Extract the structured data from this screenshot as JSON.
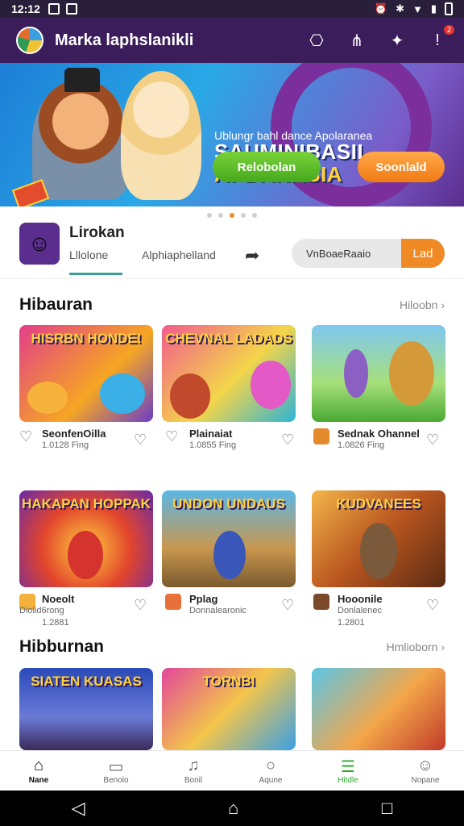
{
  "status": {
    "time": "12:12"
  },
  "app": {
    "title": "Marka laphslanikli",
    "badge": "2"
  },
  "banner": {
    "title_line1": "SAUMINIBASIL",
    "title_line2": "APDANASIA",
    "subtitle": "Ublungr bahl dance Apolaranea",
    "button_green": "Relobolan",
    "button_orange": "Soonlald"
  },
  "profile": {
    "name": "Lirokan",
    "tab1": "Lllolone",
    "tab2": "Alphiaphelland",
    "toggle_left": "VnBoaeRaaio",
    "toggle_right": "Lad"
  },
  "sections": [
    {
      "title": "Hibauran",
      "more": "Hiloobn"
    },
    {
      "title": "Hibburnan",
      "more": "Hmlioborn"
    }
  ],
  "row1": [
    {
      "thumb": "HISRBN HONDE!",
      "title": "SeonfenOilla",
      "sub": "1.0128 Fing"
    },
    {
      "thumb": "CHEVNAL LADADS",
      "title": "Plainaiat",
      "sub": "1.0855 Fing"
    },
    {
      "thumb": "",
      "title": "Sednak Ohannel",
      "sub": "1.0826 Fing"
    }
  ],
  "row2": [
    {
      "thumb": "HAKAPAN HOPPAK",
      "title": "Noeolt",
      "sub": "Diolid6rong",
      "meta": "1.2881"
    },
    {
      "thumb": "UNDON UNDAUS",
      "title": "Pplag",
      "sub": "Donnalearonic",
      "meta": ""
    },
    {
      "thumb": "KUDVANEES",
      "title": "Hooonile",
      "sub": "Donlalenec",
      "meta": "1.2801"
    }
  ],
  "row3": [
    {
      "thumb": "SIATEN KUASAS"
    },
    {
      "thumb": "TORNBI"
    },
    {
      "thumb": ""
    }
  ],
  "nav": [
    {
      "label": "Nane"
    },
    {
      "label": "Benolo"
    },
    {
      "label": "Bonil"
    },
    {
      "label": "Aqune"
    },
    {
      "label": "Hitdle"
    },
    {
      "label": "Nopane"
    }
  ]
}
